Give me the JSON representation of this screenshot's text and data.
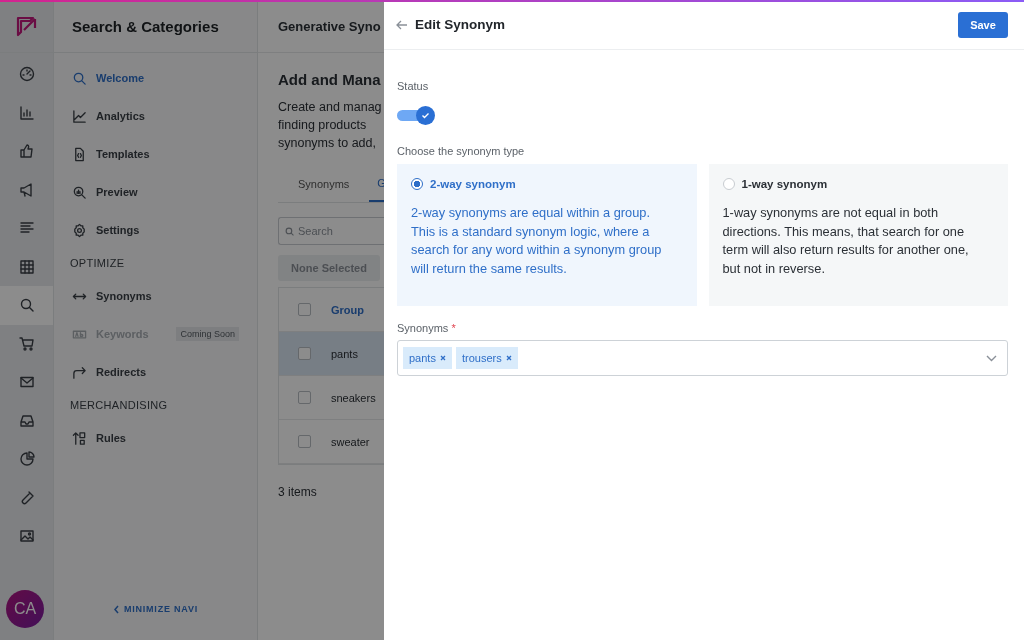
{
  "rail": {
    "items": [
      {
        "selected": false
      },
      {
        "selected": false
      },
      {
        "selected": false
      },
      {
        "selected": false
      },
      {
        "selected": false
      },
      {
        "selected": false
      },
      {
        "selected": true
      },
      {
        "selected": false
      },
      {
        "selected": false
      },
      {
        "selected": false
      },
      {
        "selected": false
      },
      {
        "selected": false
      },
      {
        "selected": false
      }
    ],
    "avatar": "CA"
  },
  "nav": {
    "title": "Search & Categories",
    "items": [
      {
        "kind": "link",
        "label": "Welcome",
        "selected": true,
        "disabled": false
      },
      {
        "kind": "link",
        "label": "Analytics",
        "selected": false,
        "disabled": false
      },
      {
        "kind": "link",
        "label": "Templates",
        "selected": false,
        "disabled": false
      },
      {
        "kind": "link",
        "label": "Preview",
        "selected": false,
        "disabled": false
      },
      {
        "kind": "link",
        "label": "Settings",
        "selected": false,
        "disabled": false
      },
      {
        "kind": "heading",
        "label": "OPTIMIZE"
      },
      {
        "kind": "link",
        "label": "Synonyms",
        "selected": false,
        "disabled": false
      },
      {
        "kind": "link",
        "label": "Keywords",
        "selected": false,
        "disabled": true,
        "badge": "Coming Soon"
      },
      {
        "kind": "link",
        "label": "Redirects",
        "selected": false,
        "disabled": false
      },
      {
        "kind": "heading",
        "label": "MERCHANDISING"
      },
      {
        "kind": "link",
        "label": "Rules",
        "selected": false,
        "disabled": false
      }
    ],
    "minimize": "MINIMIZE NAVI"
  },
  "page": {
    "title": "Generative Syno",
    "heading": "Add and Mana",
    "description_lines": [
      "Create and manag",
      "finding products",
      "synonyms to add,"
    ],
    "tabs": [
      {
        "label": "Synonyms",
        "selected": false
      },
      {
        "label": "G",
        "selected": true
      }
    ],
    "search": {
      "placeholder": "Search"
    },
    "bulk_button": "None Selected",
    "table": {
      "all_checked": false,
      "columns": [
        "Group"
      ],
      "rows": [
        {
          "group": "pants",
          "checked": false,
          "highlighted": true
        },
        {
          "group": "sneakers",
          "checked": false,
          "highlighted": false
        },
        {
          "group": "sweater",
          "checked": false,
          "highlighted": false
        }
      ]
    },
    "count": "3 items"
  },
  "drawer": {
    "title": "Edit Synonym",
    "save": "Save",
    "status_label": "Status",
    "status_on": true,
    "type_label": "Choose the synonym type",
    "types": [
      {
        "label": "2-way synonym",
        "description": "2-way synonyms are equal within a group. This is a standard synonym logic, where a search for any word within a synonym group will return the same results.",
        "selected": true
      },
      {
        "label": "1-way synonym",
        "description": "1-way synonyms are not equal in both directions. This means, that search for one term will also return results for another one, but not in reverse.",
        "selected": false
      }
    ],
    "synonyms_label": "Synonyms",
    "required_mark": "*",
    "tags": [
      "pants",
      "trousers"
    ]
  }
}
